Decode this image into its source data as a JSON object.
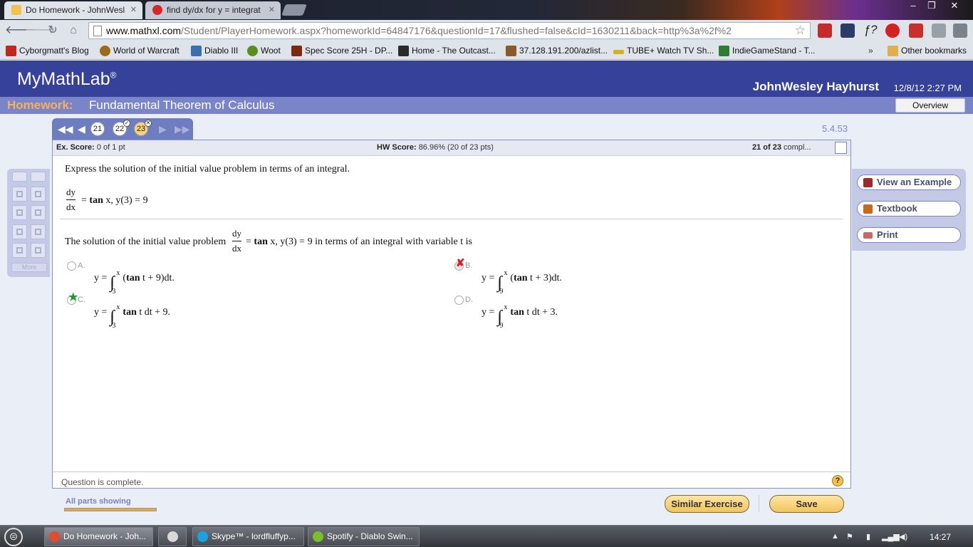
{
  "browser": {
    "tabs": [
      {
        "title": "Do Homework - JohnWesl",
        "active": true
      },
      {
        "title": "find dy/dx for y = integrat",
        "active": false
      }
    ],
    "url_domain": "www.mathxl.com",
    "url_rest": "/Student/PlayerHomework.aspx?homeworkId=64847176&questionId=17&flushed=false&cId=1630211&back=http%3a%2f%2",
    "bookmarks": [
      "Cyborgmatt's Blog",
      "World of Warcraft",
      "Diablo III",
      "Woot",
      "Spec Score 25H - DP...",
      "Home - The Outcast...",
      "37.128.191.200/azlist...",
      "TUBE+ Watch TV Sh...",
      "IndieGameStand - T..."
    ],
    "other_bookmarks": "Other bookmarks",
    "bookmarks_overflow": "»"
  },
  "app": {
    "logo": "MyMathLab",
    "logo_reg": "®",
    "user": "JohnWesley Hayhurst",
    "datetime": "12/8/12 2:27 PM"
  },
  "homework": {
    "label": "Homework:",
    "title": "Fundamental Theorem of Calculus",
    "overview": "Overview"
  },
  "question_nav": {
    "prev": "21",
    "current": "22",
    "next": "23",
    "code": "5.4.53"
  },
  "scores": {
    "ex_label": "Ex. Score:",
    "ex_value": "0 of 1 pt",
    "hw_label": "HW Score:",
    "hw_value": "86.96% (20 of 23 pts)",
    "progress_count": "21 of 23",
    "progress_suffix": "compl..."
  },
  "question": {
    "instruction": "Express the solution of the initial value problem in terms of an integral.",
    "dy": "dy",
    "dx": "dx",
    "equation_tail_bold": "tan",
    "equation_tail": "x, y(3) = 9",
    "equals": "=",
    "solution_prefix": "The solution of the initial value problem",
    "solution_suffix": "in terms of an integral with variable t is"
  },
  "choices": [
    {
      "letter": "A.",
      "lower": "3",
      "upper": "x",
      "body_pre": "(",
      "bold": "tan",
      "body_post": "t + 9)dt.",
      "mark": ""
    },
    {
      "letter": "B.",
      "lower": "9",
      "upper": "x",
      "body_pre": "(",
      "bold": "tan",
      "body_post": "t + 3)dt.",
      "mark": "✘"
    },
    {
      "letter": "C.",
      "lower": "3",
      "upper": "x",
      "body_pre": "",
      "bold": "tan",
      "body_post": "t dt + 9.",
      "mark": "★"
    },
    {
      "letter": "D.",
      "lower": "9",
      "upper": "x",
      "body_pre": "",
      "bold": "tan",
      "body_post": "t dt + 3.",
      "mark": ""
    }
  ],
  "footer": {
    "status": "Question is complete.",
    "help": "?"
  },
  "toolbox": {
    "more": "More"
  },
  "sidebar": [
    {
      "label": "View an Example",
      "icon": "example-icon"
    },
    {
      "label": "Textbook",
      "icon": "book-icon"
    },
    {
      "label": "Print",
      "icon": "printer-icon"
    }
  ],
  "bottom": {
    "all_parts": "All parts showing",
    "similar": "Similar Exercise",
    "save": "Save"
  },
  "taskbar": {
    "items": [
      "Do Homework - Joh...",
      "Skype™ - lordfluffyp...",
      "Spotify - Diablo Swin..."
    ],
    "clock": "14:27"
  }
}
